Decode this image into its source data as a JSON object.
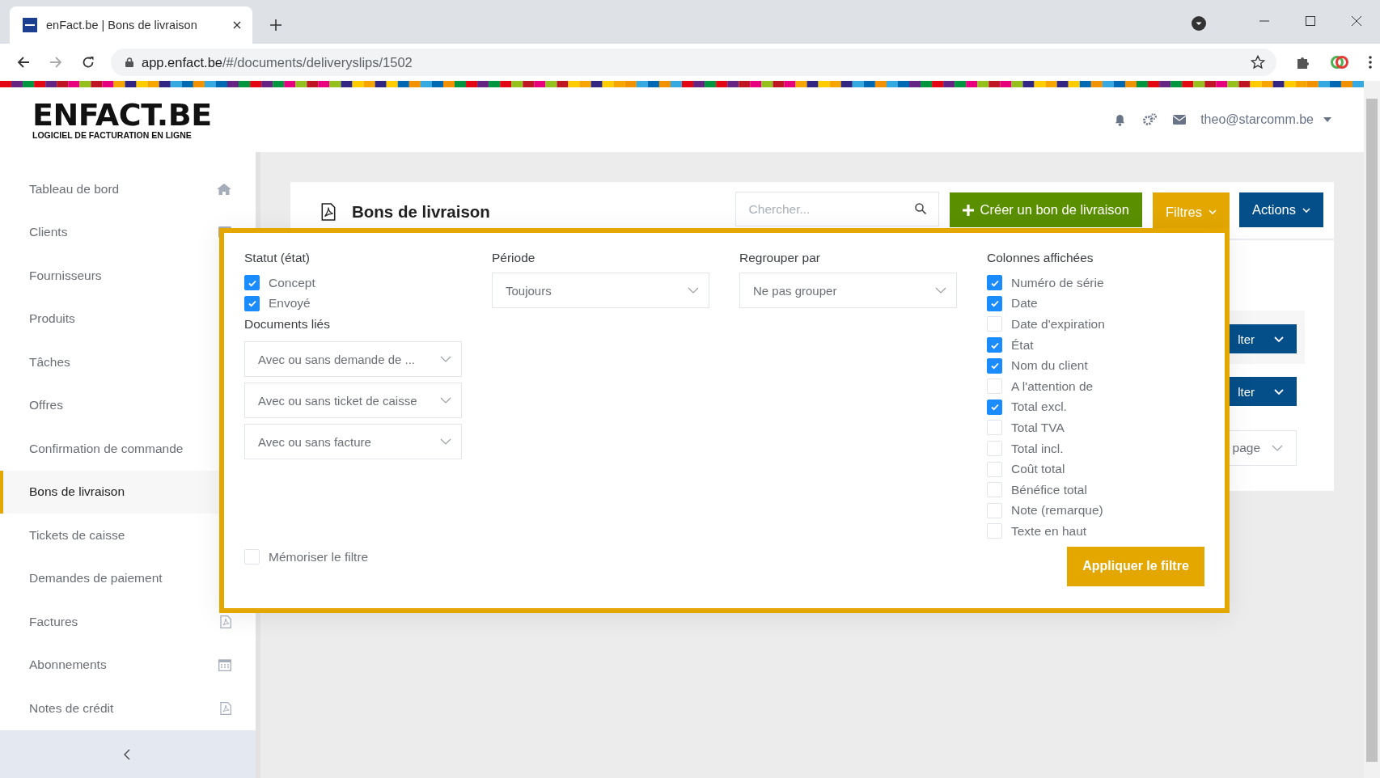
{
  "browser": {
    "tab_title": "enFact.be | Bons de livraison",
    "url_host": "app.enfact.be",
    "url_path": "/#/documents/deliveryslips/1502"
  },
  "header": {
    "logo": "ENFACT.BE",
    "tagline": "LOGICIEL DE FACTURATION EN LIGNE",
    "user": "theo@starcomm.be"
  },
  "sidebar": {
    "items": [
      {
        "label": "Tableau de bord",
        "selected": false,
        "kind": "home"
      },
      {
        "label": "Clients",
        "selected": false,
        "kind": "card"
      },
      {
        "label": "Fournisseurs",
        "selected": false
      },
      {
        "label": "Produits",
        "selected": false
      },
      {
        "label": "Tâches",
        "selected": false
      },
      {
        "label": "Offres",
        "selected": false
      },
      {
        "label": "Confirmation de commande",
        "selected": false
      },
      {
        "label": "Bons de livraison",
        "selected": true
      },
      {
        "label": "Tickets de caisse",
        "selected": false
      },
      {
        "label": "Demandes de paiement",
        "selected": false
      },
      {
        "label": "Factures",
        "selected": false,
        "kind": "pdf"
      },
      {
        "label": "Abonnements",
        "selected": false,
        "kind": "calendar"
      },
      {
        "label": "Notes de crédit",
        "selected": false,
        "kind": "pdf"
      }
    ]
  },
  "page": {
    "title": "Bons de livraison",
    "search_placeholder": "Chercher...",
    "create_button": "Créer un bon de livraison",
    "filter_button": "Filtres",
    "actions_button": "Actions",
    "row_buttons": [
      "lter",
      "lter"
    ],
    "per_page": "page"
  },
  "filters": {
    "status": {
      "label": "Statut (état)",
      "options": [
        {
          "label": "Concept",
          "checked": true
        },
        {
          "label": "Envoyé",
          "checked": true
        }
      ]
    },
    "linked": {
      "label": "Documents liés",
      "selects": [
        "Avec ou sans demande de ...",
        "Avec ou sans ticket de caisse",
        "Avec ou sans facture"
      ]
    },
    "period": {
      "label": "Période",
      "value": "Toujours"
    },
    "group": {
      "label": "Regrouper par",
      "value": "Ne pas grouper"
    },
    "columns": {
      "label": "Colonnes affichées",
      "options": [
        {
          "label": "Numéro de série",
          "checked": true
        },
        {
          "label": "Date",
          "checked": true
        },
        {
          "label": "Date d'expiration",
          "checked": false
        },
        {
          "label": "État",
          "checked": true
        },
        {
          "label": "Nom du client",
          "checked": true
        },
        {
          "label": "A l'attention de",
          "checked": false
        },
        {
          "label": "Total excl.",
          "checked": true
        },
        {
          "label": "Total TVA",
          "checked": false
        },
        {
          "label": "Total incl.",
          "checked": false
        },
        {
          "label": "Coût total",
          "checked": false
        },
        {
          "label": "Bénéfice total",
          "checked": false
        },
        {
          "label": "Note (remarque)",
          "checked": false
        },
        {
          "label": "Texte en haut",
          "checked": false
        }
      ]
    },
    "remember": {
      "label": "Mémoriser le filtre",
      "checked": false
    },
    "apply_button": "Appliquer le filtre"
  }
}
